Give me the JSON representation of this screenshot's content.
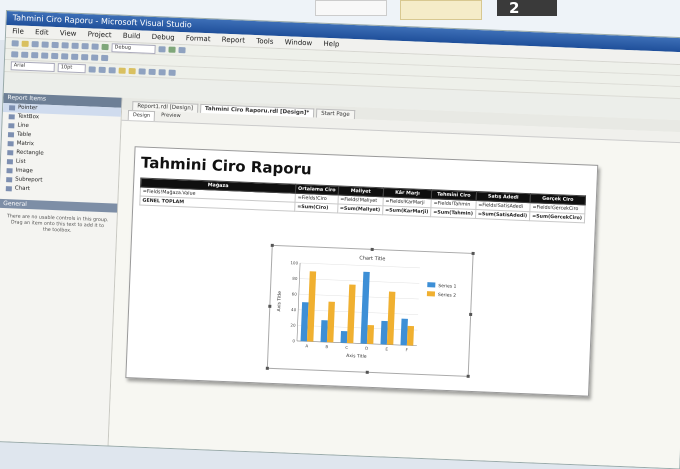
{
  "step_badge": "2",
  "window": {
    "title": "Tahmini Ciro Raporu - Microsoft Visual Studio"
  },
  "menu": [
    "File",
    "Edit",
    "View",
    "Project",
    "Build",
    "Debug",
    "Format",
    "Report",
    "Tools",
    "Window",
    "Help"
  ],
  "toolbar": {
    "config_select": "Debug",
    "font_select": "Arial",
    "size_select": "10pt"
  },
  "toolbox": {
    "header": "Report Items",
    "items": [
      "Pointer",
      "TextBox",
      "Line",
      "Table",
      "Matrix",
      "Rectangle",
      "List",
      "Image",
      "Subreport",
      "Chart"
    ],
    "general_header": "General",
    "general_text": "There are no usable controls in this group. Drag an item onto this text to add it to the toolbox."
  },
  "doc_tabs": [
    "Report1.rdl [Design]",
    "Tahmini Ciro Raporu.rdl [Design]*",
    "Start Page"
  ],
  "sub_tabs": [
    "Design",
    "Preview"
  ],
  "report": {
    "title": "Tahmini Ciro Raporu",
    "headers": [
      "Mağaza",
      "Ortalama Ciro",
      "Maliyet",
      "Kâr Marjı",
      "Tahmini Ciro",
      "Satış Adedi",
      "Gerçek Ciro"
    ],
    "rows": [
      [
        "=Fields!Mağaza.Value",
        "=Fields!Ciro",
        "=Fields!Maliyet",
        "=Fields!KarMarji",
        "=Fields!Tahmin",
        "=Fields!SatisAdedi",
        "=Fields!GercekCiro"
      ],
      [
        "GENEL TOPLAM",
        "=Sum(Ciro)",
        "=Sum(Maliyet)",
        "=Sum(KarMarji)",
        "=Sum(Tahmin)",
        "=Sum(SatisAdedi)",
        "=Sum(GercekCiro)"
      ]
    ]
  },
  "chart_data": {
    "type": "bar",
    "title": "Chart Title",
    "xlabel": "Axis Title",
    "ylabel": "Axis Title",
    "categories": [
      "A",
      "B",
      "C",
      "D",
      "E",
      "F"
    ],
    "series": [
      {
        "name": "Series 1",
        "values": [
          50,
          28,
          15,
          92,
          30,
          34
        ],
        "color": "#3d8fd6"
      },
      {
        "name": "Series 2",
        "values": [
          90,
          52,
          75,
          24,
          68,
          25
        ],
        "color": "#f0b030"
      }
    ],
    "ylim": [
      0,
      100
    ],
    "yticks": [
      0,
      20,
      40,
      60,
      80,
      100
    ],
    "legend": "right"
  },
  "colors": {
    "title_bar": "#1f4f9a",
    "table_header": "#0f0f0f",
    "series1": "#3d8fd6",
    "series2": "#f0b030"
  }
}
